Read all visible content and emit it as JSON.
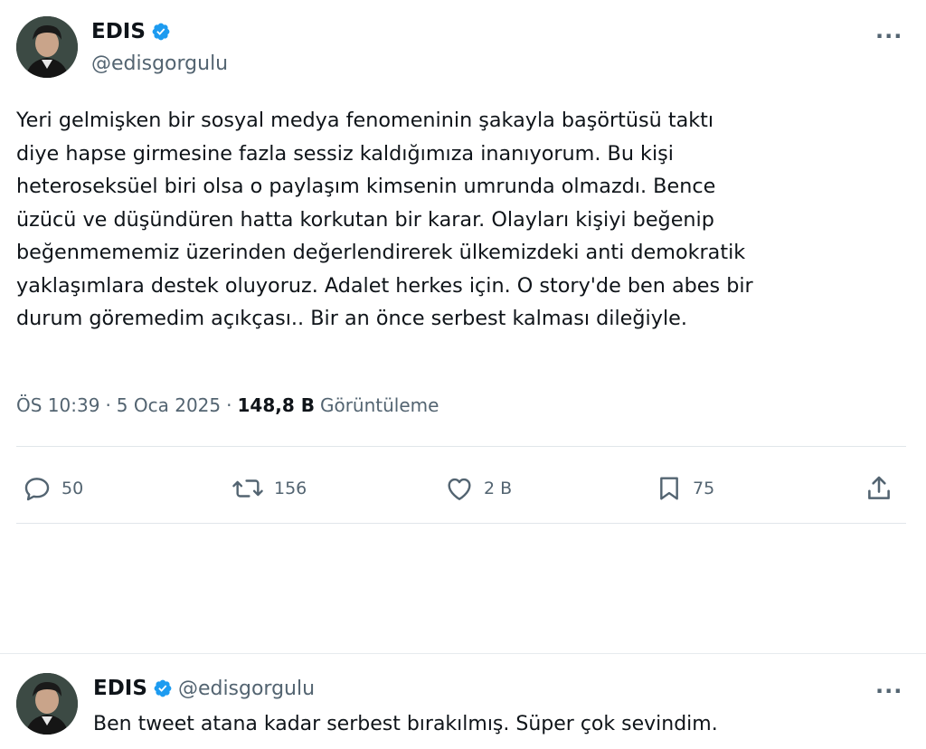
{
  "tweet": {
    "author": {
      "display_name": "EDIS",
      "handle": "@edisgorgulu",
      "verified": true
    },
    "lines": [
      "Yeri gelmişken bir sosyal medya fenomeninin şakayla başörtüsü taktı",
      "diye hapse girmesine fazla sessiz kaldığımıza inanıyorum. Bu kişi",
      "heteroseksüel biri olsa o paylaşım kimsenin umrunda olmazdı. Bence",
      "üzücü ve düşündüren hatta korkutan bir karar. Olayları kişiyi beğenip",
      "beğenmememiz üzerinden değerlendirerek ülkemizdeki anti demokratik",
      "yaklaşımlara destek oluyoruz. Adalet herkes için. O story'de ben abes bir",
      "durum göremedim açıkçası.. Bir an önce serbest kalması dileğiyle."
    ],
    "time": "ÖS 10:39",
    "date": "5 Oca 2025",
    "separator": "·",
    "views_count": "148,8 B",
    "views_label": "Görüntüleme",
    "actions": {
      "replies": "50",
      "reposts": "156",
      "likes": "2 B",
      "bookmarks": "75"
    }
  },
  "reply": {
    "author": {
      "display_name": "EDIS",
      "handle": "@edisgorgulu",
      "verified": true
    },
    "text": "Ben tweet atana kadar serbest bırakılmış. Süper çok sevindim."
  },
  "more_menu_glyph": "···",
  "colors": {
    "verified": "#1d9bf0",
    "secondary_text": "#536471",
    "primary_text": "#0f1419"
  },
  "icons": [
    "verified-badge-icon",
    "more-icon",
    "reply-icon",
    "repost-icon",
    "like-icon",
    "bookmark-icon",
    "share-icon"
  ]
}
